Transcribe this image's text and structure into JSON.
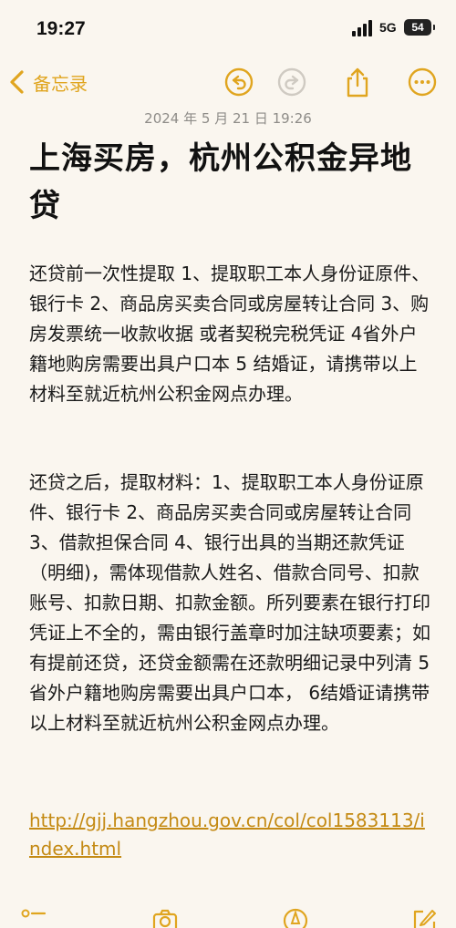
{
  "status_bar": {
    "time": "19:27",
    "network": "5G",
    "battery": "54"
  },
  "nav": {
    "back_label": "备忘录",
    "icons": [
      "undo-icon",
      "redo-icon",
      "share-icon",
      "more-icon"
    ],
    "accent_color": "#e0a51f"
  },
  "note": {
    "date": "2024 年 5 月 21 日 19:26",
    "title": "上海买房，杭州公积金异地贷",
    "paragraphs": [
      "还贷前一次性提取 1、提取职工本人身份证原件、银行卡 2、商品房买卖合同或房屋转让合同 3、购房发票统一收款收据 或者契税完税凭证 4省外户籍地购房需要出具户口本 5 结婚证，请携带以上材料至就近杭州公积金网点办理。",
      "还贷之后，提取材料：1、提取职工本人身份证原件、银行卡 2、商品房买卖合同或房屋转让合同 3、借款担保合同 4、银行出具的当期还款凭证（明细)，需体现借款人姓名、借款合同号、扣款账号、扣款日期、扣款金额。所列要素在银行打印凭证上不全的，需由银行盖章时加注缺项要素；如有提前还贷，还贷金额需在还款明细记录中列清 5省外户籍地购房需要出具户口本， 6结婚证请携带以上材料至就近杭州公积金网点办理。"
    ],
    "link": "http://gjj.hangzhou.gov.cn/col/col1583113/index.html"
  },
  "toolbar": {
    "icons": [
      "checklist-icon",
      "camera-icon",
      "markup-icon",
      "compose-icon"
    ]
  }
}
